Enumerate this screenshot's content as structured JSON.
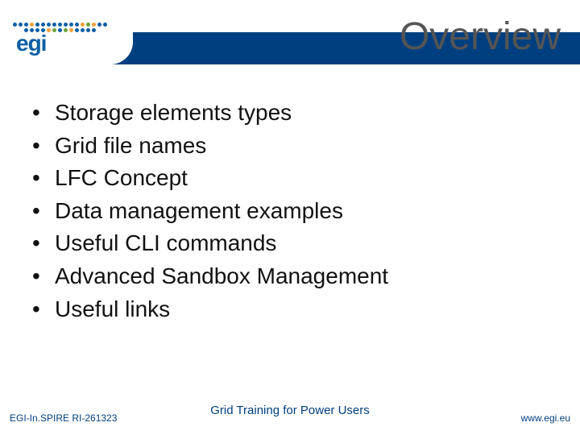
{
  "header": {
    "title": "Overview",
    "logo_text": "egi"
  },
  "bullets": [
    "Storage elements types",
    "Grid file names",
    "LFC Concept",
    "Data management examples",
    "Useful CLI commands",
    "Advanced Sandbox Management",
    "Useful links"
  ],
  "footer": {
    "left": "EGI-In.SPIRE RI-261323",
    "center": "Grid Training for Power Users",
    "right": "www.egi.eu"
  }
}
